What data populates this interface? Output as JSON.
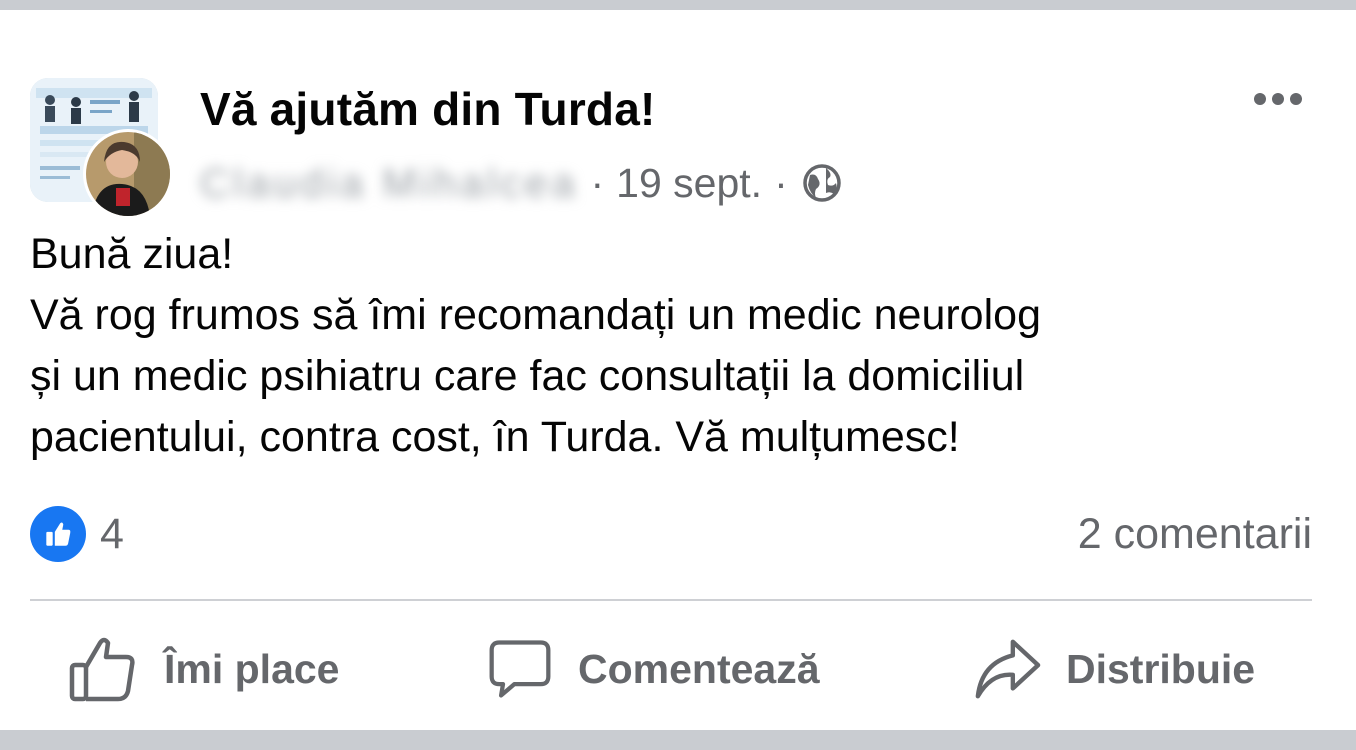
{
  "post": {
    "group_name": "Vă ajutăm din Turda!",
    "author_name": "Claudia Mihalcea",
    "separator": "·",
    "date": "19 sept.",
    "privacy_icon": "globe-icon",
    "text_lines": [
      "Bună ziua!",
      "Vă rog frumos să îmi recomandați un medic neurolog",
      "și un medic psihiatru care fac consultații la domiciliul",
      "pacientului, contra cost, în Turda. Vă mulțumesc!"
    ],
    "like_count": "4",
    "comments_label": "2 comentarii",
    "more_icon": "more-icon"
  },
  "actions": {
    "like_label": "Îmi place",
    "comment_label": "Comentează",
    "share_label": "Distribuie"
  },
  "colors": {
    "like_blue": "#1877f2",
    "secondary_text": "#65676b",
    "primary_text": "#050505",
    "divider": "#ced0d4"
  }
}
